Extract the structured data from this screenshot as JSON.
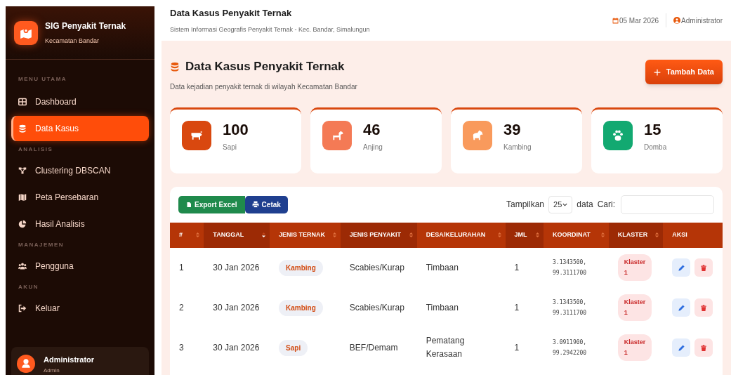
{
  "brand": {
    "title": "SIG Penyakit Ternak",
    "subtitle": "Kecamatan Bandar"
  },
  "sidebar": {
    "sections": [
      {
        "heading": "MENU UTAMA",
        "items": [
          {
            "label": "Dashboard",
            "selected": false
          },
          {
            "label": "Data Kasus",
            "selected": true
          }
        ]
      },
      {
        "heading": "ANALISIS",
        "items": [
          {
            "label": "Clustering DBSCAN",
            "selected": false
          },
          {
            "label": "Peta Persebaran",
            "selected": false
          },
          {
            "label": "Hasil Analisis",
            "selected": false
          }
        ]
      },
      {
        "heading": "MANAJEMEN",
        "items": [
          {
            "label": "Pengguna",
            "selected": false
          }
        ]
      },
      {
        "heading": "AKUN",
        "items": [
          {
            "label": "Keluar",
            "selected": false
          }
        ]
      }
    ],
    "user": {
      "name": "Administrator",
      "role": "Admin"
    }
  },
  "topbar": {
    "title": "Data Kasus Penyakit Ternak",
    "subtitle": "Sistem Informasi Geografis Penyakit Ternak - Kec. Bandar, Simalungun",
    "date": "05 Mar 2026",
    "user": "Administrator"
  },
  "page": {
    "title": "Data Kasus Penyakit Ternak",
    "subtitle": "Data kejadian penyakit ternak di wilayah Kecamatan Bandar",
    "add_button": "Tambah Data"
  },
  "stats": [
    {
      "value": "100",
      "label": "Sapi",
      "color": "#d9480f"
    },
    {
      "value": "46",
      "label": "Anjing",
      "color": "#f47a55"
    },
    {
      "value": "39",
      "label": "Kambing",
      "color": "#f99a5c"
    },
    {
      "value": "15",
      "label": "Domba",
      "color": "#12a971"
    }
  ],
  "toolbar": {
    "export_button": "Export Excel",
    "print_button": "Cetak",
    "show_label": "Tampilkan",
    "page_size": "25",
    "data_label": "data",
    "search_label": "Cari:"
  },
  "table": {
    "columns": [
      {
        "label": "#",
        "sortable": true,
        "sorted": false
      },
      {
        "label": "TANGGAL",
        "sortable": true,
        "sorted": true
      },
      {
        "label": "JENIS TERNAK",
        "sortable": true,
        "sorted": false
      },
      {
        "label": "JENIS PENYAKIT",
        "sortable": true,
        "sorted": false
      },
      {
        "label": "DESA/KELURAHAN",
        "sortable": true,
        "sorted": false
      },
      {
        "label": "JML",
        "sortable": true,
        "sorted": false
      },
      {
        "label": "KOORDINAT",
        "sortable": true,
        "sorted": false
      },
      {
        "label": "KLASTER",
        "sortable": true,
        "sorted": false
      },
      {
        "label": "AKSI",
        "sortable": false
      }
    ],
    "rows": [
      {
        "no": "1",
        "date": "30 Jan 2026",
        "animal": "Kambing",
        "disease": "Scabies/Kurap",
        "village": "Timbaan",
        "count": "1",
        "coords": "3.1343500,\n99.3111700",
        "cluster": "Klaster\n1"
      },
      {
        "no": "2",
        "date": "30 Jan 2026",
        "animal": "Kambing",
        "disease": "Scabies/Kurap",
        "village": "Timbaan",
        "count": "1",
        "coords": "3.1343500,\n99.3111700",
        "cluster": "Klaster\n1"
      },
      {
        "no": "3",
        "date": "30 Jan 2026",
        "animal": "Sapi",
        "disease": "BEF/Demam",
        "village": "Pematang\nKerasaan",
        "count": "1",
        "coords": "3.0911900,\n99.2942200",
        "cluster": "Klaster\n1"
      }
    ]
  }
}
